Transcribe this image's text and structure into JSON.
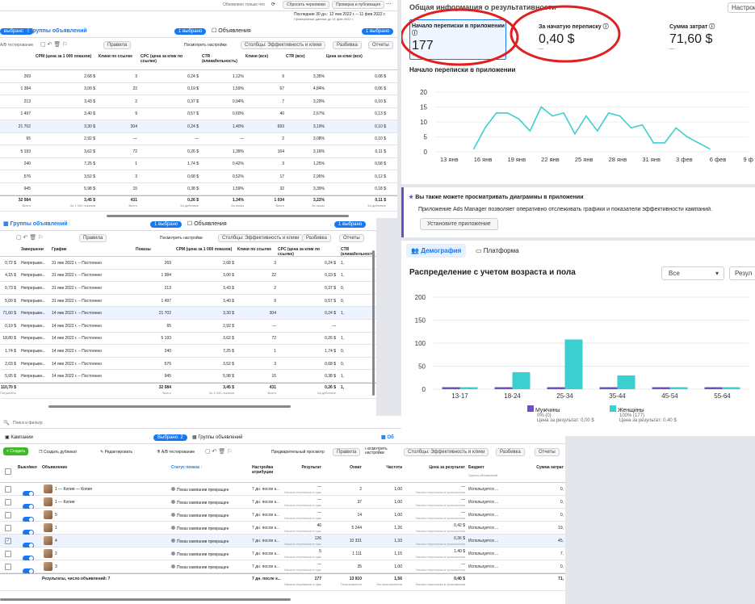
{
  "p1": {
    "topbar": {
      "sync": "Обновлено только что",
      "discard": "Сбросить черновики",
      "review": "Проверка и публикация",
      "daterange": "Последние 30 дн.: 12 янв 2022 г. – 11 фев 2022 г.",
      "datenote": "Проверенные данные до 11 фев 2022 г."
    },
    "tab_sel": "выбрано: 2",
    "tab_groups": "Группы объявлений",
    "tab_groups_sel": "1 выбрано",
    "tab_ads": "Объявления",
    "tab_ads_sel": "1 выбрано",
    "toolbar": {
      "a": "А/В тестирование",
      "rules": "Правила",
      "view": "Посмотреть настройки",
      "cols": "Столбцы: Эффективность и клики",
      "breakdown": "Разбивка",
      "reports": "Отчеты"
    },
    "headers": [
      "",
      "CPM (цена за 1 000 показов)",
      "Клики по ссылке",
      "CPC (цена за клик по ссылке)",
      "CTR (кликабельность)",
      "Клики (все)",
      "CTR (все)",
      "Цена за клик (все)"
    ],
    "rows": [
      [
        "269",
        "2,68 $",
        "3",
        "0,24 $",
        "1,12%",
        "9",
        "3,35%",
        "0,08 $"
      ],
      [
        "1 384",
        "3,00 $",
        "22",
        "0,19 $",
        "1,59%",
        "67",
        "4,84%",
        "0,06 $"
      ],
      [
        "213",
        "3,43 $",
        "2",
        "0,37 $",
        "0,94%",
        "7",
        "3,29%",
        "0,10 $"
      ],
      [
        "1 497",
        "3,40 $",
        "9",
        "0,57 $",
        "0,60%",
        "40",
        "2,67%",
        "0,13 $"
      ],
      [
        "21 702",
        "3,30 $",
        "304",
        "0,24 $",
        "1,40%",
        "693",
        "3,19%",
        "0,10 $"
      ],
      [
        "65",
        "2,92 $",
        "—",
        "—",
        "—",
        "2",
        "3,08%",
        "0,10 $"
      ],
      [
        "5 193",
        "3,62 $",
        "72",
        "0,26 $",
        "1,39%",
        "164",
        "3,16%",
        "0,11 $"
      ],
      [
        "240",
        "7,25 $",
        "1",
        "1,74 $",
        "0,42%",
        "3",
        "1,25%",
        "0,58 $"
      ],
      [
        "576",
        "3,52 $",
        "3",
        "0,68 $",
        "0,52%",
        "17",
        "2,95%",
        "0,12 $"
      ],
      [
        "945",
        "5,98 $",
        "15",
        "0,38 $",
        "1,59%",
        "32",
        "3,39%",
        "0,18 $"
      ]
    ],
    "total": [
      "32 084",
      "3,45 $",
      "431",
      "0,26 $",
      "1,34%",
      "1 034",
      "3,22%",
      "0,11 $"
    ],
    "total_notes": [
      "Всего",
      "За 1 000 показов",
      "Всего",
      "За действие",
      "За показ",
      "Всего",
      "За показ",
      "За действие"
    ]
  },
  "p2": {
    "tab_groups": "Группы объявлений",
    "tab_groups_sel": "1 выбрано",
    "tab_ads": "Объявления",
    "tab_ads_sel": "1 выбрано",
    "toolbar": {
      "rules": "Правила",
      "view": "Посмотреть настройки",
      "cols": "Столбцы: Эффективность и клики",
      "breakdown": "Разбивка",
      "reports": "Отчеты"
    },
    "headers": [
      "",
      "Завершени",
      "График",
      "Показы",
      "CPM (цена за 1 000 показов)",
      "Клики по ссылке",
      "CPC (цена за клик по ссылке)",
      "CTR (кликабельност"
    ],
    "rows": [
      [
        "0,72 $",
        "Непрерывн...",
        "31 янв 2022 г. – Постоянно",
        "269",
        "2,68 $",
        "3",
        "0,24 $",
        "1,"
      ],
      [
        "4,15 $",
        "Непрерывн...",
        "31 янв 2022 г. – Постоянно",
        "1 384",
        "3,00 $",
        "22",
        "0,19 $",
        "1,"
      ],
      [
        "0,73 $",
        "Непрерывн...",
        "31 янв 2022 г. – Постоянно",
        "213",
        "3,43 $",
        "2",
        "0,37 $",
        "0,"
      ],
      [
        "5,09 $",
        "Непрерывн...",
        "31 янв 2022 г. – Постоянно",
        "1 497",
        "3,40 $",
        "9",
        "0,57 $",
        "0,"
      ],
      [
        "71,60 $",
        "Непрерывн...",
        "14 янв 2022 г. – Постоянно",
        "21 702",
        "3,30 $",
        "304",
        "0,24 $",
        "1,"
      ],
      [
        "0,19 $",
        "Непрерывн...",
        "14 янв 2022 г. – Постоянно",
        "65",
        "2,92 $",
        "—",
        "—",
        ""
      ],
      [
        "18,80 $",
        "Непрерывн...",
        "14 янв 2022 г. – Постоянно",
        "5 193",
        "3,62 $",
        "72",
        "0,26 $",
        "1,"
      ],
      [
        "1,74 $",
        "Непрерывн...",
        "14 янв 2022 г. – Постоянно",
        "240",
        "7,25 $",
        "1",
        "1,74 $",
        "0,"
      ],
      [
        "2,03 $",
        "Непрерывн...",
        "14 янв 2022 г. – Постоянно",
        "576",
        "3,52 $",
        "3",
        "0,68 $",
        "0,"
      ],
      [
        "5,65 $",
        "Непрерывн...",
        "14 янв 2022 г. – Постоянно",
        "945",
        "5,98 $",
        "15",
        "0,38 $",
        "1,"
      ]
    ],
    "total": [
      "110,70 $",
      "",
      "",
      "32 084",
      "3,45 $",
      "431",
      "0,26 $",
      "1,"
    ],
    "total_notes": [
      "Потрачено",
      "",
      "",
      "Всего",
      "За 1 000 показов",
      "Всего",
      "За действие",
      ""
    ]
  },
  "p3": {
    "search": "Поиск и фильтр",
    "tab_campaigns": "Кампании",
    "tab_sel": "Выбрано: 2",
    "tab_groups": "Группы объявлений",
    "tab_ads": "Об",
    "toolbar": {
      "create": "+ Создать",
      "dup": "Создать дубликат",
      "edit": "Редактировать",
      "ab": "А/В тестирование",
      "preview": "Предварительный просмотр",
      "rules": "Правила",
      "view": "Посмотреть настройки",
      "cols": "Столбцы: Эффективность и клики",
      "breakdown": "Разбивка",
      "reports": "Отчеты"
    },
    "headers": [
      "Выкл/вкл",
      "Объявление",
      "Статус показа ↑",
      "Настройка атрибуции",
      "Результат",
      "Охват",
      "Частота",
      "Цена за результат",
      "Бюджет",
      "Сумма затрат"
    ],
    "budget_note": "Группа объявлений",
    "rows": [
      {
        "name": "1 — Копия — Копия",
        "status": "Показ кампании прекращен",
        "attr": "7 дн. после к...",
        "result": "—",
        "reach": "2",
        "freq": "1,00",
        "cpr": "—",
        "budget": "Используется ...",
        "spend": "0,"
      },
      {
        "name": "1 — Копия",
        "status": "Показ кампании прекращен",
        "attr": "7 дн. после к...",
        "result": "—",
        "reach": "37",
        "freq": "1,00",
        "cpr": "—",
        "budget": "Используется ...",
        "spend": "0,"
      },
      {
        "name": "5",
        "status": "Показ кампании прекращен",
        "attr": "7 дн. после к...",
        "result": "—",
        "reach": "14",
        "freq": "1,00",
        "cpr": "—",
        "budget": "Используется ...",
        "spend": "0,"
      },
      {
        "name": "1",
        "status": "Показ кампании прекращен",
        "attr": "7 дн. после к...",
        "result": "46",
        "reach": "5 244",
        "freq": "1,26",
        "cpr": "0,42 $",
        "budget": "Используется ...",
        "spend": "19,"
      },
      {
        "name": "4",
        "status": "Показ кампании прекращен",
        "attr": "7 дн. после к...",
        "result": "126",
        "reach": "10 331",
        "freq": "1,33",
        "cpr": "0,36 $",
        "budget": "Используется ...",
        "spend": "45,"
      },
      {
        "name": "2",
        "status": "Показ кампании прекращен",
        "attr": "7 дн. после к...",
        "result": "5",
        "reach": "1 111",
        "freq": "1,15",
        "cpr": "1,40 $",
        "budget": "Используется ...",
        "spend": "7,"
      },
      {
        "name": "3",
        "status": "Показ кампании прекращен",
        "attr": "7 дн. после к...",
        "result": "—",
        "reach": "35",
        "freq": "1,00",
        "cpr": "—",
        "budget": "Используется ...",
        "spend": "0,"
      }
    ],
    "row_note": "Начало переписки в приложении",
    "total": {
      "label": "Результаты, число объявлений: 7",
      "attr": "7 дн. после к...",
      "result": "177",
      "reach": "13 910",
      "freq": "1,56",
      "cpr": "0,40 $",
      "spend": "71,"
    },
    "total_notes": {
      "result": "Начало переписки в приложении",
      "reach": "Пользователи",
      "freq": "На пользователя",
      "cpr": "Начало переписки в приложении"
    }
  },
  "summary": {
    "title": "Общая информация о результативности",
    "settings": "Настрои",
    "kpis": [
      {
        "label": "Начало переписки в приложении",
        "value": "177",
        "sub": "—"
      },
      {
        "label": "За начатую переписку",
        "value": "0,40 $",
        "sub": "—"
      },
      {
        "label": "Сумма затрат",
        "value": "71,60 $",
        "sub": "—"
      }
    ],
    "line_title": "Начало переписки в приложении",
    "promo_title": "Вы также можете просматривать диаграммы в приложении",
    "promo_text": "Приложение Ads Manager позволяет оперативно отслеживать графики и показатели эффективности кампаний.",
    "promo_btn": "Установите приложение",
    "tab_demo": "Демография",
    "tab_platform": "Платформа",
    "bar_title": "Распределение с учетом возраста и пола",
    "select_all": "Все",
    "select_res": "Резул",
    "legend": [
      {
        "name": "Мужчины",
        "share": "0% (0)",
        "cost": "Цена за результат: 0,00 $"
      },
      {
        "name": "Женщины",
        "share": "100% (177)",
        "cost": "Цена за результат: 0,40 $"
      }
    ],
    "colors": {
      "men": "#6e4fc4",
      "women": "#3ccfcf",
      "accent": "#1877f2",
      "circle": "#e02020"
    }
  },
  "chart_data": [
    {
      "type": "line",
      "title": "Начало переписки в приложении",
      "x_ticks": [
        "13 янв",
        "16 янв",
        "19 янв",
        "22 янв",
        "25 янв",
        "28 янв",
        "31 янв",
        "3 фев",
        "6 фев",
        "9 ф"
      ],
      "ylim": [
        0,
        20
      ],
      "y_ticks": [
        0,
        5,
        10,
        15,
        20
      ],
      "x": [
        "15 янв",
        "16 янв",
        "17 янв",
        "18 янв",
        "19 янв",
        "20 янв",
        "21 янв",
        "22 янв",
        "23 янв",
        "24 янв",
        "25 янв",
        "26 янв",
        "27 янв",
        "28 янв",
        "29 янв",
        "30 янв",
        "31 янв",
        "1 фев",
        "2 фев",
        "3 фев",
        "4 фев",
        "5 фев"
      ],
      "series": [
        {
          "values": [
            1,
            8,
            13,
            13,
            11,
            7,
            15,
            12,
            13,
            6,
            12,
            7,
            13,
            12,
            8,
            9,
            3,
            3,
            8,
            5,
            3,
            1
          ]
        }
      ]
    },
    {
      "type": "bar",
      "title": "Распределение с учетом возраста и пола",
      "categories": [
        "13-17",
        "18-24",
        "25-34",
        "35-44",
        "45-54",
        "55-64"
      ],
      "ylim": [
        0,
        200
      ],
      "y_ticks": [
        0,
        50,
        100,
        150,
        200
      ],
      "series": [
        {
          "name": "Мужчины",
          "values": [
            0,
            0,
            0,
            0,
            0,
            0
          ]
        },
        {
          "name": "Женщины",
          "values": [
            0,
            37,
            108,
            30,
            1,
            0
          ]
        }
      ]
    }
  ]
}
